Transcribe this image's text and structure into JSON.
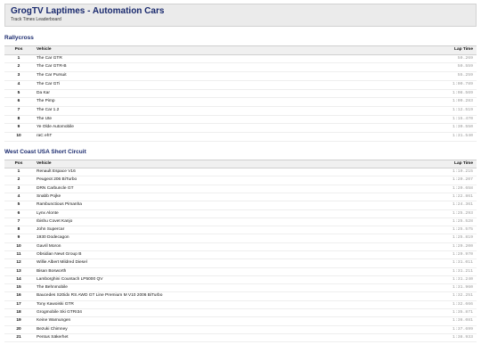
{
  "header": {
    "title": "GrogTV Laptimes - Automation Cars",
    "subtitle": "Track Times Leaderboard"
  },
  "columns": {
    "pos": "Pos",
    "vehicle": "Vehicle",
    "time": "Lap Time"
  },
  "sections": [
    {
      "title": "Rallycross",
      "rows": [
        {
          "pos": "1",
          "vehicle": "The Car GTR",
          "time": "50.269"
        },
        {
          "pos": "2",
          "vehicle": "The Car GTR-B",
          "time": "50.559"
        },
        {
          "pos": "3",
          "vehicle": "The Car Pursuit",
          "time": "55.259"
        },
        {
          "pos": "4",
          "vehicle": "The Car GTi",
          "time": "1:00.789"
        },
        {
          "pos": "5",
          "vehicle": "Da Kar",
          "time": "1:08.569"
        },
        {
          "pos": "6",
          "vehicle": "The Pimp",
          "time": "1:09.283"
        },
        {
          "pos": "7",
          "vehicle": "The Car 1.2",
          "time": "1:12.519"
        },
        {
          "pos": "8",
          "vehicle": "The Ute",
          "time": "1:15.470"
        },
        {
          "pos": "9",
          "vehicle": "Ye Olde Automobile",
          "time": "1:30.550"
        },
        {
          "pos": "10",
          "vehicle": "raC ehT",
          "time": "1:31.540"
        }
      ]
    },
    {
      "title": "West Coast USA Short Circuit",
      "rows": [
        {
          "pos": "1",
          "vehicle": "Renault Espace V16",
          "time": "1:19.215"
        },
        {
          "pos": "2",
          "vehicle": "Peugeot 206 BiTurbo",
          "time": "1:20.207"
        },
        {
          "pos": "3",
          "vehicle": "DRN Carbuncle GT",
          "time": "1:20.658"
        },
        {
          "pos": "4",
          "vehicle": "Snabb Pojke",
          "time": "1:22.861"
        },
        {
          "pos": "5",
          "vehicle": "Rambunctious Pimanha",
          "time": "1:24.361"
        },
        {
          "pos": "6",
          "vehicle": "Lynx Alonte",
          "time": "1:25.293"
        },
        {
          "pos": "7",
          "vehicle": "Ibishu Covet Kanjo",
          "time": "1:25.528"
        },
        {
          "pos": "8",
          "vehicle": "John Supercar",
          "time": "1:25.575"
        },
        {
          "pos": "9",
          "vehicle": "1930 Dodecagon",
          "time": "1:25.819"
        },
        {
          "pos": "10",
          "vehicle": "Gavril Moron",
          "time": "1:29.200"
        },
        {
          "pos": "11",
          "vehicle": "Obsidian Newt Group B",
          "time": "1:29.970"
        },
        {
          "pos": "12",
          "vehicle": "Willie Albert Mildred Diesel",
          "time": "1:31.011"
        },
        {
          "pos": "13",
          "vehicle": "Bisan Bosworth",
          "time": "1:31.211"
        },
        {
          "pos": "14",
          "vehicle": "Lamborghini Countach LP5000 QV",
          "time": "1:31.240"
        },
        {
          "pos": "15",
          "vehicle": "The Behnmobile",
          "time": "1:31.960"
        },
        {
          "pos": "16",
          "vehicle": "Baucedes S20idx RS AWD GT Line Premium M V10 2006 BiTurbo",
          "time": "1:32.251"
        },
        {
          "pos": "17",
          "vehicle": "Tony Kawoiski GTR",
          "time": "1:32.666"
        },
        {
          "pos": "18",
          "vehicle": "Grogmobile Ski GTRI34",
          "time": "1:35.871"
        },
        {
          "pos": "19",
          "vehicle": "Keine Warnungen",
          "time": "1:36.081"
        },
        {
          "pos": "20",
          "vehicle": "Bezuki Chimney",
          "time": "1:37.699"
        },
        {
          "pos": "21",
          "vehicle": "Pentus Säkerhet",
          "time": "1:38.933"
        }
      ]
    }
  ]
}
